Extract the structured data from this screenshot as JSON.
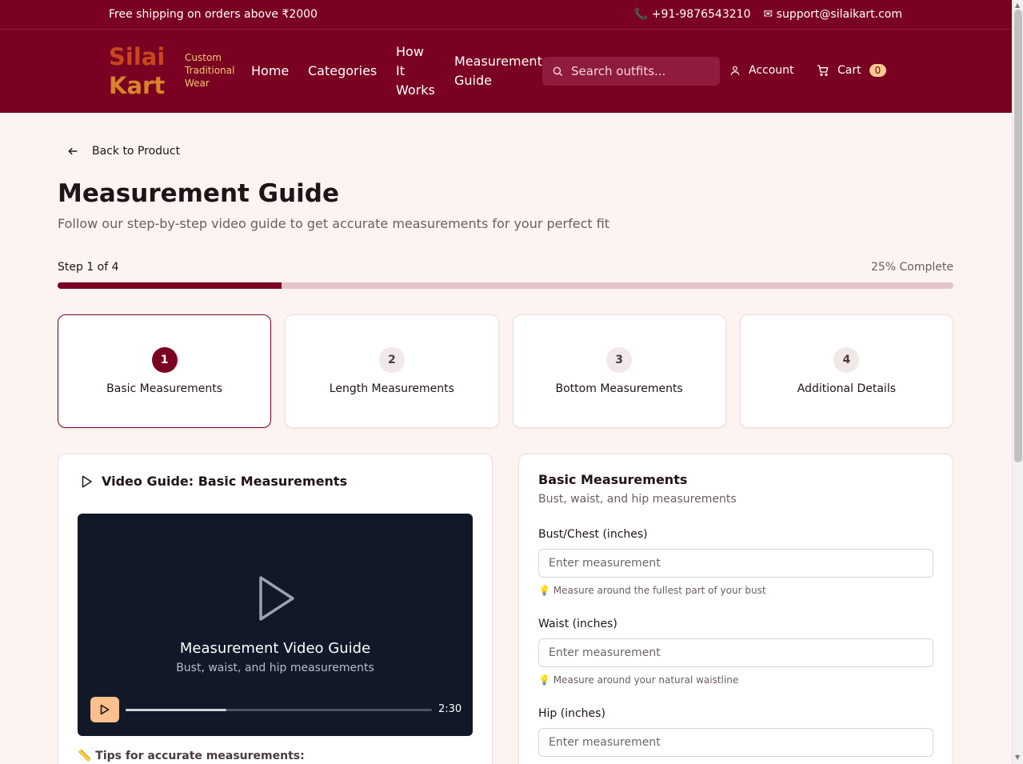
{
  "topbar": {
    "shipping": "Free shipping on orders above ₹2000",
    "phone": "📞 +91-9876543210",
    "email": "✉ support@silaikart.com"
  },
  "brand": {
    "line1": "Silai",
    "line2": "Kart",
    "tagline": "Custom Traditional Wear"
  },
  "nav": {
    "home": "Home",
    "categories": "Categories",
    "how": "How It Works",
    "guide": "Measurement Guide"
  },
  "search": {
    "placeholder": "Search outfits..."
  },
  "account": "Account",
  "cart": {
    "label": "Cart",
    "count": "0"
  },
  "back": "Back to Product",
  "page": {
    "title": "Measurement Guide",
    "subtitle": "Follow our step-by-step video guide to get accurate measurements for your perfect fit"
  },
  "progress": {
    "label": "Step 1 of 4",
    "percent_text": "25% Complete",
    "value": 0.25
  },
  "steps": [
    {
      "num": "1",
      "name": "Basic Measurements"
    },
    {
      "num": "2",
      "name": "Length Measurements"
    },
    {
      "num": "3",
      "name": "Bottom Measurements"
    },
    {
      "num": "4",
      "name": "Additional Details"
    }
  ],
  "video": {
    "heading": "Video Guide: Basic Measurements",
    "title": "Measurement Video Guide",
    "subtitle": "Bust, waist, and hip measurements",
    "duration": "2:30",
    "progress": 0.33,
    "tips": "📏 Tips for accurate measurements:"
  },
  "form": {
    "title": "Basic Measurements",
    "subtitle": "Bust, waist, and hip measurements",
    "fields": [
      {
        "label": "Bust/Chest (inches)",
        "placeholder": "Enter measurement",
        "hint": "💡 Measure around the fullest part of your bust"
      },
      {
        "label": "Waist (inches)",
        "placeholder": "Enter measurement",
        "hint": "💡 Measure around your natural waistline"
      },
      {
        "label": "Hip (inches)",
        "placeholder": "Enter measurement",
        "hint": ""
      }
    ]
  },
  "colors": {
    "brand": "#7a0122",
    "accent": "#fbc08d",
    "background": "#fdf3f1"
  }
}
